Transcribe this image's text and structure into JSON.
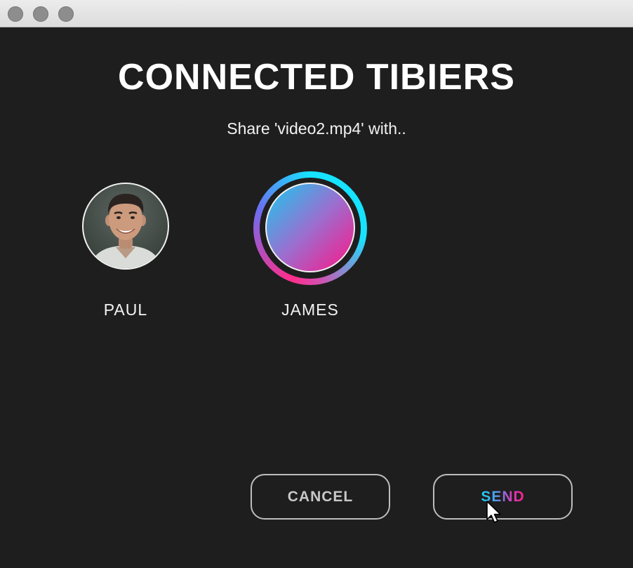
{
  "window": {
    "title": "CONNECTED TIBIERS",
    "subtitle": "Share 'video2.mp4' with.."
  },
  "contacts": [
    {
      "name": "PAUL",
      "avatar": "photo",
      "selected": false
    },
    {
      "name": "JAMES",
      "avatar": "gradient",
      "selected": true
    }
  ],
  "buttons": {
    "cancel_label": "CANCEL",
    "send_label": "SEND"
  },
  "icons": {
    "window_controls": [
      "close-button-icon",
      "minimize-button-icon",
      "zoom-button-icon"
    ],
    "cursor": "mouse-pointer-icon"
  },
  "colors": {
    "background": "#1e1e1e",
    "accent_cyan": "#16e3ff",
    "accent_pink": "#ff1585",
    "text": "#ffffff"
  }
}
